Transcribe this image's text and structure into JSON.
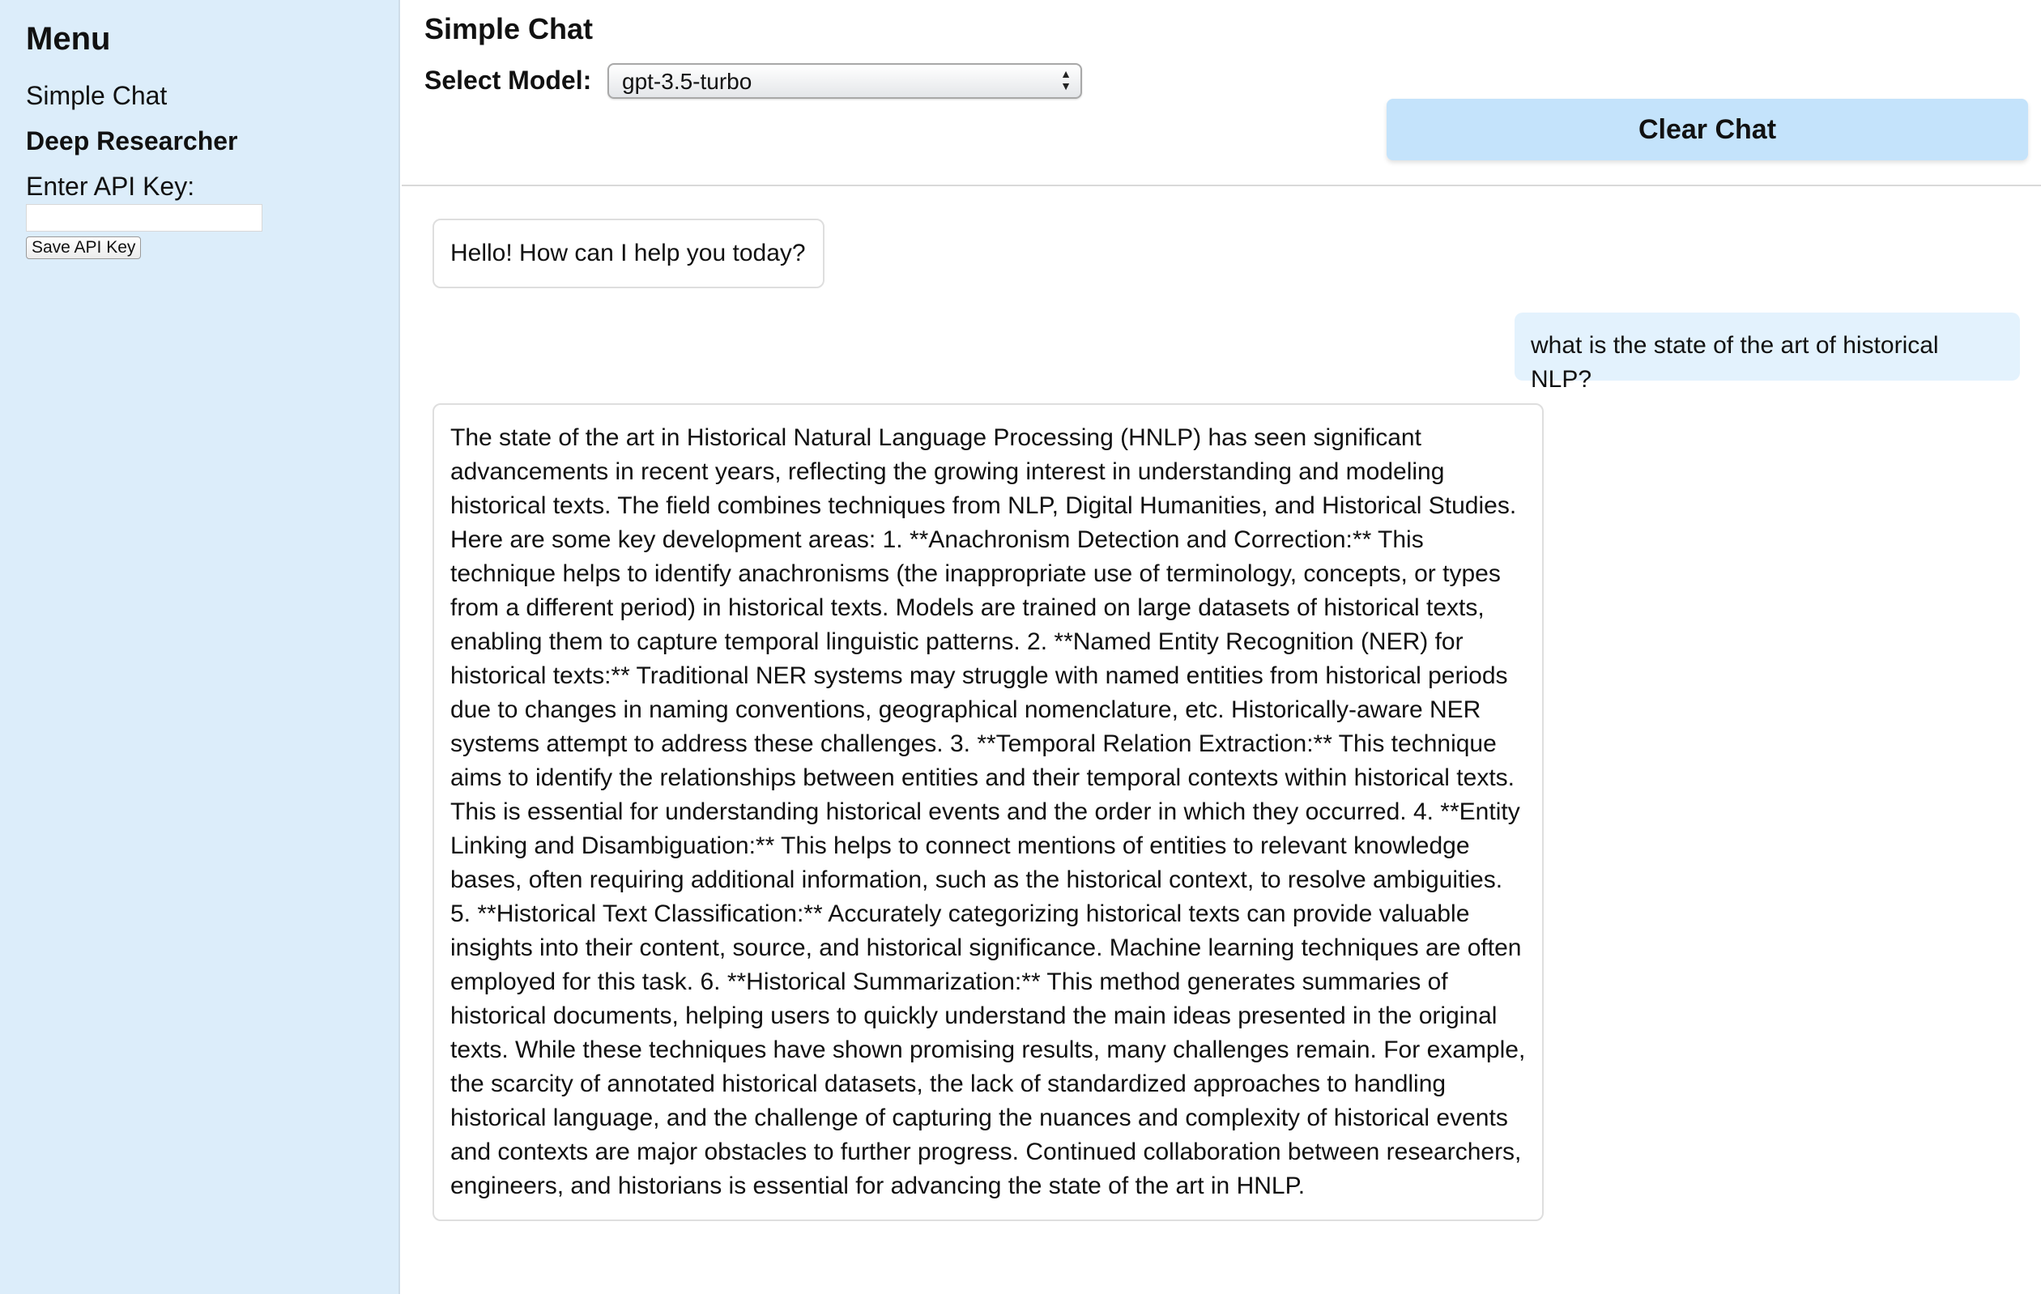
{
  "sidebar": {
    "title": "Menu",
    "items": [
      {
        "label": "Simple Chat"
      },
      {
        "label": "Deep Researcher"
      }
    ],
    "api_key_label": "Enter API Key:",
    "api_key_value": "",
    "save_button_label": "Save API Key"
  },
  "header": {
    "title": "Simple Chat",
    "model_label": "Select Model:",
    "model_selected": "gpt-3.5-turbo",
    "clear_button_label": "Clear Chat"
  },
  "chat": {
    "messages": [
      {
        "role": "assistant",
        "text": "Hello! How can I help you today?"
      },
      {
        "role": "user",
        "text": "what is the state of the art of historical NLP?"
      },
      {
        "role": "assistant",
        "text": "The state of the art in Historical Natural Language Processing (HNLP) has seen significant advancements in recent years, reflecting the growing interest in understanding and modeling historical texts. The field combines techniques from NLP, Digital Humanities, and Historical Studies. Here are some key development areas: 1. **Anachronism Detection and Correction:** This technique helps to identify anachronisms (the inappropriate use of terminology, concepts, or types from a different period) in historical texts. Models are trained on large datasets of historical texts, enabling them to capture temporal linguistic patterns. 2. **Named Entity Recognition (NER) for historical texts:** Traditional NER systems may struggle with named entities from historical periods due to changes in naming conventions, geographical nomenclature, etc. Historically-aware NER systems attempt to address these challenges. 3. **Temporal Relation Extraction:** This technique aims to identify the relationships between entities and their temporal contexts within historical texts. This is essential for understanding historical events and the order in which they occurred. 4. **Entity Linking and Disambiguation:** This helps to connect mentions of entities to relevant knowledge bases, often requiring additional information, such as the historical context, to resolve ambiguities. 5. **Historical Text Classification:** Accurately categorizing historical texts can provide valuable insights into their content, source, and historical significance. Machine learning techniques are often employed for this task. 6. **Historical Summarization:** This method generates summaries of historical documents, helping users to quickly understand the main ideas presented in the original texts. While these techniques have shown promising results, many challenges remain. For example, the scarcity of annotated historical datasets, the lack of standardized approaches to handling historical language, and the challenge of capturing the nuances and complexity of historical events and contexts are major obstacles to further progress. Continued collaboration between researchers, engineers, and historians is essential for advancing the state of the art in HNLP."
      }
    ]
  }
}
